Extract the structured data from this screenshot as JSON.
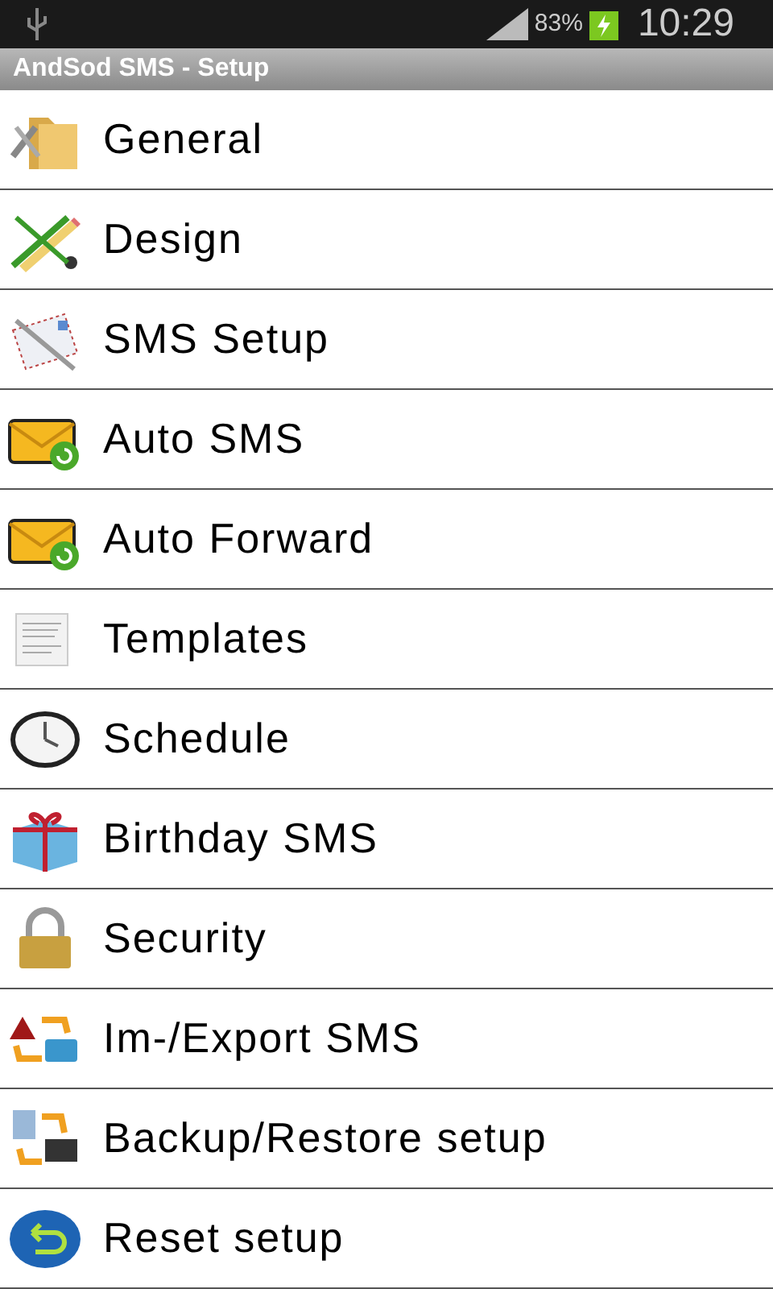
{
  "status_bar": {
    "battery": "83%",
    "time": "10:29"
  },
  "window": {
    "title": "AndSod SMS - Setup"
  },
  "menu": [
    {
      "label": "General",
      "kind": "folder-tools"
    },
    {
      "label": "Design",
      "kind": "pencil-brush"
    },
    {
      "label": "SMS Setup",
      "kind": "envelope-pen"
    },
    {
      "label": "Auto SMS",
      "kind": "envelope-arrow"
    },
    {
      "label": "Auto Forward",
      "kind": "envelope-arrow"
    },
    {
      "label": "Templates",
      "kind": "document"
    },
    {
      "label": "Schedule",
      "kind": "clock"
    },
    {
      "label": "Birthday SMS",
      "kind": "gift"
    },
    {
      "label": "Security",
      "kind": "padlock"
    },
    {
      "label": "Im-/Export SMS",
      "kind": "transfer-shapes"
    },
    {
      "label": "Backup/Restore setup",
      "kind": "transfer-computer"
    },
    {
      "label": "Reset setup",
      "kind": "undo"
    }
  ]
}
